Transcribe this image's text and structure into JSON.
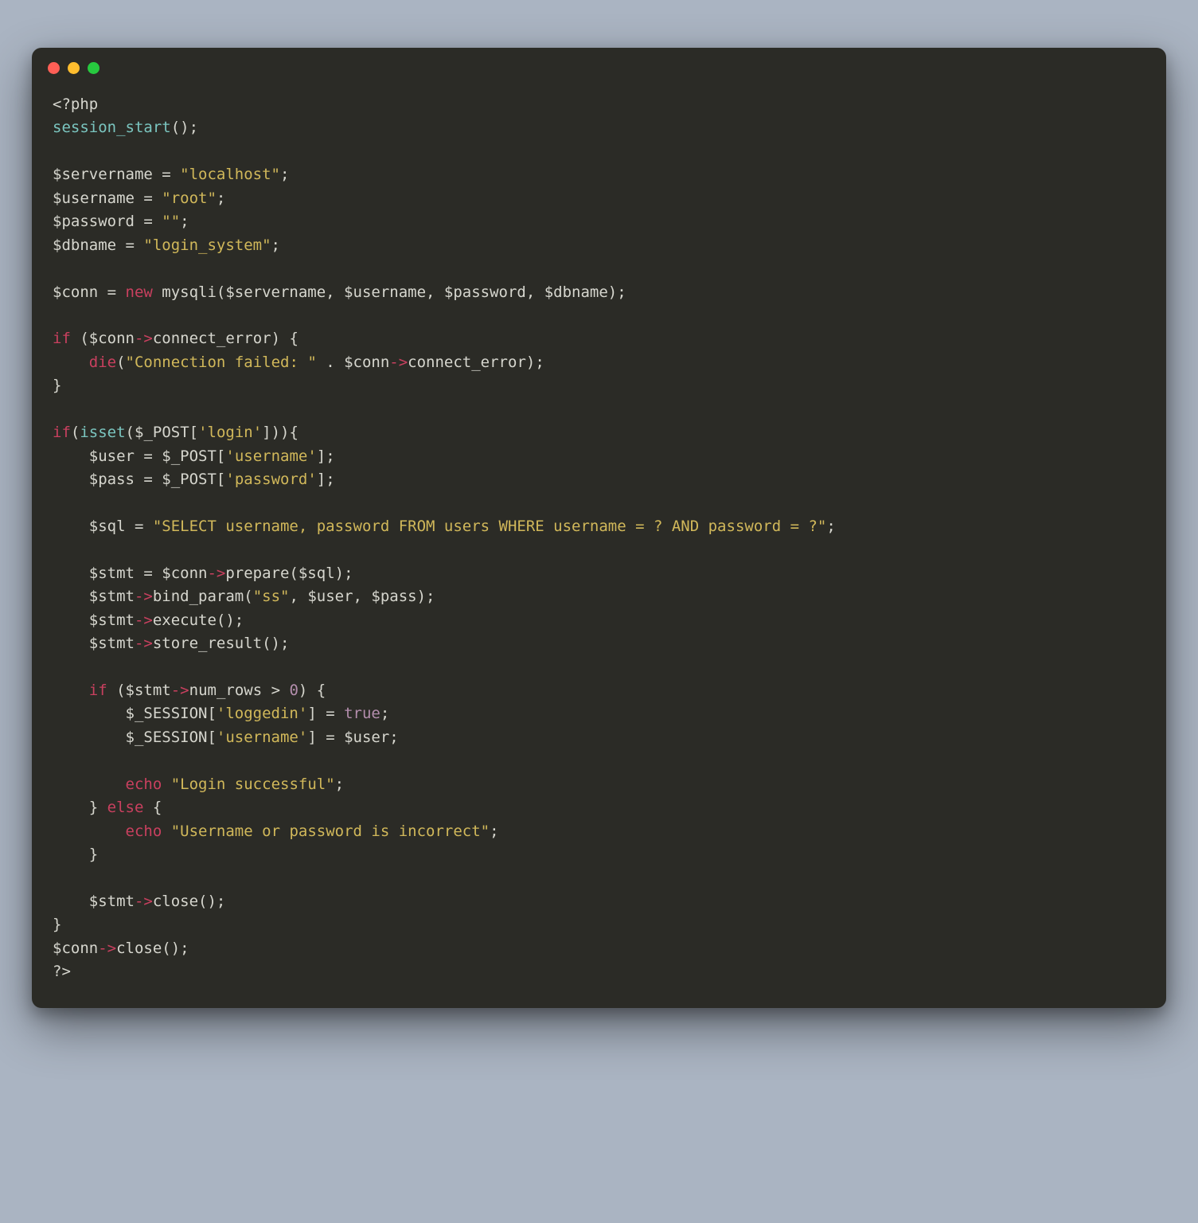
{
  "window": {
    "traffic_lights": [
      "red",
      "yellow",
      "green"
    ]
  },
  "code": {
    "open_tag": "<?php",
    "session_start_fn": "session_start",
    "session_start_call": "();",
    "servername_decl": "$servername = ",
    "servername_val": "\"localhost\"",
    "username_decl": "$username = ",
    "username_val": "\"root\"",
    "password_decl": "$password = ",
    "password_val": "\"\"",
    "dbname_decl": "$dbname = ",
    "dbname_val": "\"login_system\"",
    "semicolon": ";",
    "conn_decl": "$conn = ",
    "new_kw": "new",
    "mysqli_call": " mysqli($servername, $username, $password, $dbname);",
    "if_kw": "if",
    "conn_err_cond_open": " ($conn",
    "arrow": "->",
    "connect_error": "connect_error) {",
    "die_kw": "die",
    "die_open": "(",
    "die_str": "\"Connection failed: \"",
    "die_concat": " . $conn",
    "die_rest": "connect_error);",
    "close_brace": "}",
    "isset_fn": "isset",
    "isset_open": "(",
    "post_global": "$_POST",
    "login_key": "'login'",
    "isset_close": "])){",
    "user_decl": "    $user = ",
    "username_key": "'username'",
    "bracket_close_semi": "];",
    "pass_decl": "    $pass = ",
    "password_key": "'password'",
    "sql_decl": "    $sql = ",
    "sql_str": "\"SELECT username, password FROM users WHERE username = ? AND password = ?\"",
    "stmt_decl": "    $stmt = $conn",
    "prepare_call": "prepare($sql);",
    "stmt_var": "    $stmt",
    "bind_param_call": "bind_param(",
    "bind_types": "\"ss\"",
    "bind_args": ", $user, $pass);",
    "execute_call": "execute();",
    "store_result_call": "store_result();",
    "num_rows_cond_open": " ($stmt",
    "num_rows": "num_rows > ",
    "zero": "0",
    "cond_close": ") {",
    "session_glob": "$_SESSION",
    "loggedin_key": "'loggedin'",
    "eq": "] = ",
    "true_const": "true",
    "session_user_key": "'username'",
    "session_user_val": "] = $user;",
    "echo_kw": "echo",
    "login_success": "\"Login successful\"",
    "else_kw": "else",
    "else_open": " {",
    "login_fail": "\"Username or password is incorrect\"",
    "stmt_close_call": "close();",
    "conn_var": "$conn",
    "close_tag": "?>",
    "indent4": "    ",
    "indent8": "        ",
    "bracket_open": "[",
    "space": " "
  }
}
